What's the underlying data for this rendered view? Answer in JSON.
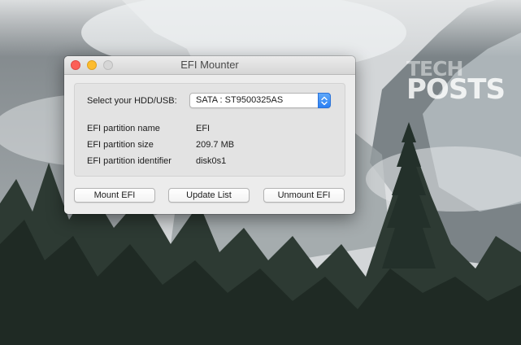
{
  "desktop": {
    "watermark_top": "TECH",
    "watermark_bottom": "POSTS"
  },
  "window": {
    "title": "EFI Mounter",
    "traffic_lights": [
      "close-icon",
      "minimize-icon",
      "zoom-icon"
    ],
    "colors": {
      "close": "#fc5f57",
      "minimize": "#fdbc2e",
      "zoom_inactive": "#d6d6d6",
      "popup_accent": "#2a7ff3"
    }
  },
  "drive_selector": {
    "label": "Select your HDD/USB:",
    "selected": "SATA : ST9500325AS",
    "icon": "chevron-updown-icon"
  },
  "partition_info": {
    "name_label": "EFI partition name",
    "name_value": "EFI",
    "size_label": "EFI partition size",
    "size_value": "209.7 MB",
    "identifier_label": "EFI partition identifier",
    "identifier_value": "disk0s1"
  },
  "buttons": {
    "mount": "Mount EFI",
    "update": "Update List",
    "unmount": "Unmount EFI"
  }
}
